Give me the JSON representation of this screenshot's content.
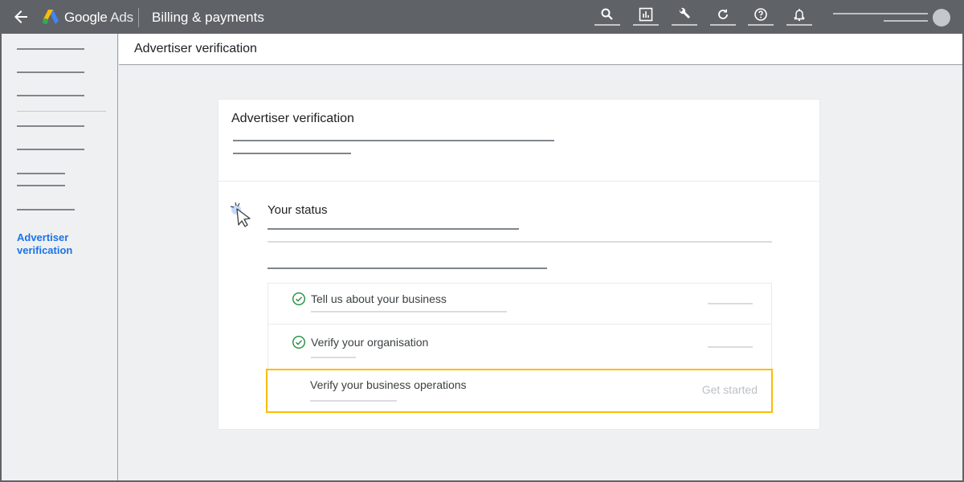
{
  "topbar": {
    "back_icon": "arrow-left-icon",
    "brand_google": "Google",
    "brand_ads": "Ads",
    "section_title": "Billing & payments",
    "tools": [
      {
        "icon": "search-icon"
      },
      {
        "icon": "reports-icon"
      },
      {
        "icon": "tools-wrench-icon"
      },
      {
        "icon": "refresh-icon"
      },
      {
        "icon": "help-icon"
      },
      {
        "icon": "notifications-bell-icon"
      }
    ],
    "account_avatar": "avatar"
  },
  "sidebar": {
    "active_item": "Advertiser verification"
  },
  "page": {
    "title": "Advertiser verification"
  },
  "card": {
    "title": "Advertiser verification",
    "status_title": "Your status",
    "steps": [
      {
        "label": "Tell us about your business",
        "status": "complete",
        "action": ""
      },
      {
        "label": "Verify your organisation",
        "status": "complete",
        "action": ""
      },
      {
        "label": "Verify your business operations",
        "status": "pending",
        "action": "Get started"
      }
    ]
  },
  "colors": {
    "topbar": "#5f6368",
    "accent_blue": "#1a73e8",
    "check_green": "#1e8e3e",
    "highlight_yellow": "#fbbc04"
  }
}
